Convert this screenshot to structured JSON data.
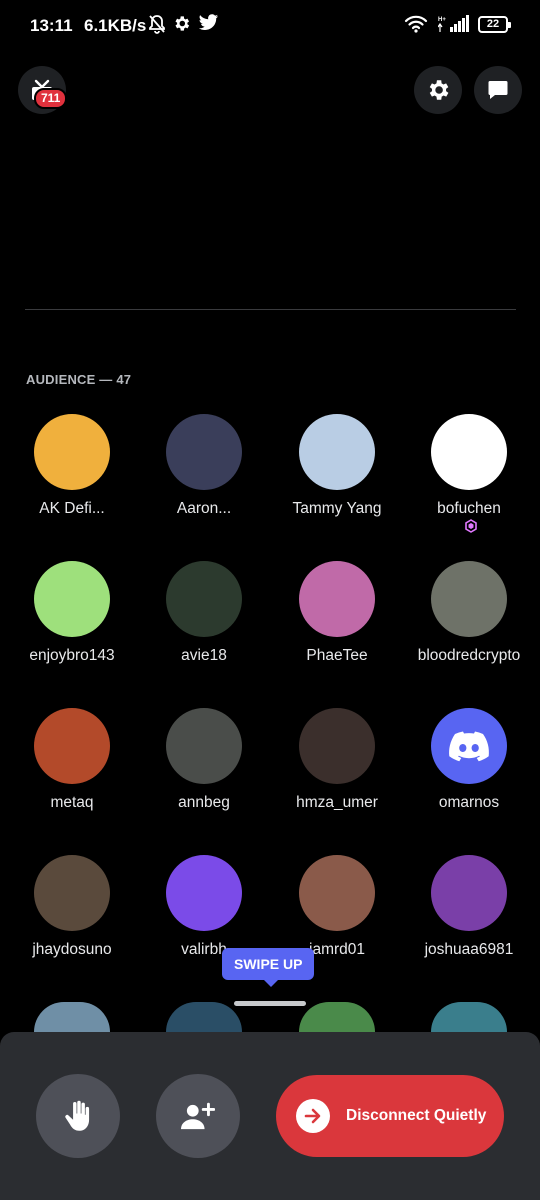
{
  "status_bar": {
    "time": "13:11",
    "speed": "6.1KB/s",
    "battery": "22"
  },
  "header": {
    "stage_badge_count": "711"
  },
  "audience": {
    "label": "AUDIENCE — 47",
    "members": [
      {
        "name": "AK Defi...",
        "avatar_color": "#f0b03d"
      },
      {
        "name": "Aaron...",
        "avatar_color": "#3a3e5a"
      },
      {
        "name": "Tammy Yang",
        "avatar_color": "#b9cde4"
      },
      {
        "name": "bofuchen",
        "avatar_color": "#ffffff",
        "nitro": true
      },
      {
        "name": "enjoybro143",
        "avatar_color": "#9ee07c"
      },
      {
        "name": "avie18",
        "avatar_color": "#2c3a2e"
      },
      {
        "name": "PhaeTee",
        "avatar_color": "#c06aa8"
      },
      {
        "name": "bloodredcrypto",
        "avatar_color": "#6e7268"
      },
      {
        "name": "metaq",
        "avatar_color": "#b34a2a"
      },
      {
        "name": "annbeg",
        "avatar_color": "#4a4d4a"
      },
      {
        "name": "hmza_umer",
        "avatar_color": "#3b2f2c"
      },
      {
        "name": "omarnos",
        "avatar_color": "#5865f2"
      },
      {
        "name": "jhaydosuno",
        "avatar_color": "#5a4a3c"
      },
      {
        "name": "valirbh",
        "avatar_color": "#7b4be8"
      },
      {
        "name": "iamrd01",
        "avatar_color": "#8a5a4a"
      },
      {
        "name": "joshuaa6981",
        "avatar_color": "#7a3fa8"
      }
    ],
    "partial_avatars": [
      {
        "avatar_color": "#6f8fa6"
      },
      {
        "avatar_color": "#2a4e66"
      },
      {
        "avatar_color": "#4a8a4a"
      },
      {
        "avatar_color": "#3a7e8c"
      }
    ]
  },
  "tooltip": {
    "text": "SWIPE UP"
  },
  "controls": {
    "disconnect_label": "Disconnect Quietly",
    "disconnect_color": "#da373c"
  }
}
